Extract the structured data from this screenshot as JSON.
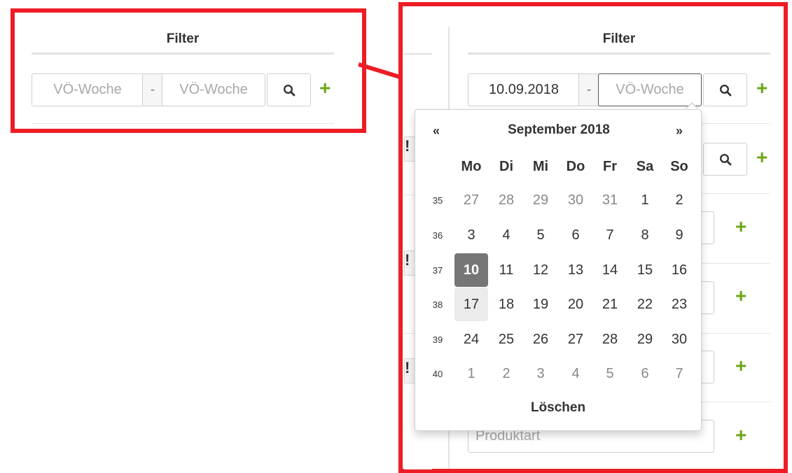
{
  "left_panel": {
    "filter_title": "Filter",
    "from_placeholder": "VÖ-Woche",
    "separator": "-",
    "to_placeholder": "VÖ-Woche"
  },
  "right_panel": {
    "filter_title": "Filter",
    "from_value": "10.09.2018",
    "separator": "-",
    "to_placeholder": "VÖ-Woche",
    "produktart_placeholder": "Produktart"
  },
  "datepicker": {
    "month_title": "September 2018",
    "prev_label": "«",
    "next_label": "»",
    "weekdays": [
      "Mo",
      "Di",
      "Mi",
      "Do",
      "Fr",
      "Sa",
      "So"
    ],
    "weeks": [
      {
        "number": "35",
        "days": [
          "27",
          "28",
          "29",
          "30",
          "31",
          "1",
          "2"
        ]
      },
      {
        "number": "36",
        "days": [
          "3",
          "4",
          "5",
          "6",
          "7",
          "8",
          "9"
        ]
      },
      {
        "number": "37",
        "days": [
          "10",
          "11",
          "12",
          "13",
          "14",
          "15",
          "16"
        ]
      },
      {
        "number": "38",
        "days": [
          "17",
          "18",
          "19",
          "20",
          "21",
          "22",
          "23"
        ]
      },
      {
        "number": "39",
        "days": [
          "24",
          "25",
          "26",
          "27",
          "28",
          "29",
          "30"
        ]
      },
      {
        "number": "40",
        "days": [
          "1",
          "2",
          "3",
          "4",
          "5",
          "6",
          "7"
        ]
      }
    ],
    "selected_day": "10",
    "highlighted_day": "17",
    "clear_label": "Löschen"
  },
  "icons": {
    "search": "search-icon",
    "add": "plus-icon"
  },
  "colors": {
    "annotation_red": "#ee1c25",
    "add_green": "#6ea617",
    "selected_gray": "#767676"
  }
}
